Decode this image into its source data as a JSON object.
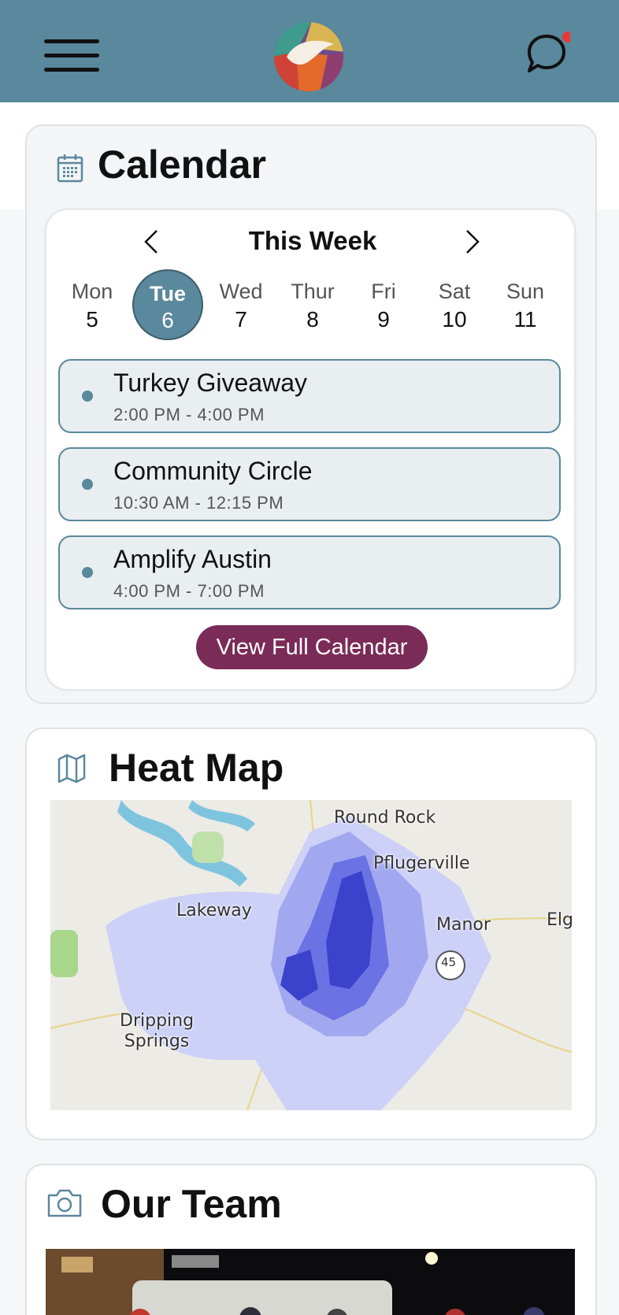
{
  "header": {
    "menu_icon": "hamburger-menu-icon",
    "logo_icon": "phoenix-logo",
    "chat_icon": "chat-bubble-icon",
    "notification_color": "#e53935",
    "bar_color": "#5a889c"
  },
  "calendar": {
    "icon": "calendar-icon",
    "title": "Calendar",
    "week_label": "This Week",
    "prev_icon": "chevron-left-icon",
    "next_icon": "chevron-right-icon",
    "days": [
      {
        "name": "Mon",
        "num": "5"
      },
      {
        "name": "Tue",
        "num": "6"
      },
      {
        "name": "Wed",
        "num": "7"
      },
      {
        "name": "Thur",
        "num": "8"
      },
      {
        "name": "Fri",
        "num": "9"
      },
      {
        "name": "Sat",
        "num": "10"
      },
      {
        "name": "Sun",
        "num": "11"
      }
    ],
    "selected_day": "Tue",
    "events": [
      {
        "name": "Turkey Giveaway",
        "time": "2:00 PM - 4:00 PM"
      },
      {
        "name": "Community Circle",
        "time": "10:30 AM - 12:15 PM"
      },
      {
        "name": "Amplify Austin",
        "time": "4:00 PM - 7:00 PM"
      }
    ],
    "button_label": "View Full Calendar",
    "button_color": "#7a2b57"
  },
  "heatmap": {
    "icon": "map-icon",
    "title": "Heat Map",
    "places": [
      "Round Rock",
      "Pflugerville",
      "Lakeway",
      "Manor",
      "Elgin",
      "Dripping\nSprings"
    ],
    "highway_marker": "45"
  },
  "team": {
    "icon": "camera-icon",
    "title": "Our Team"
  }
}
